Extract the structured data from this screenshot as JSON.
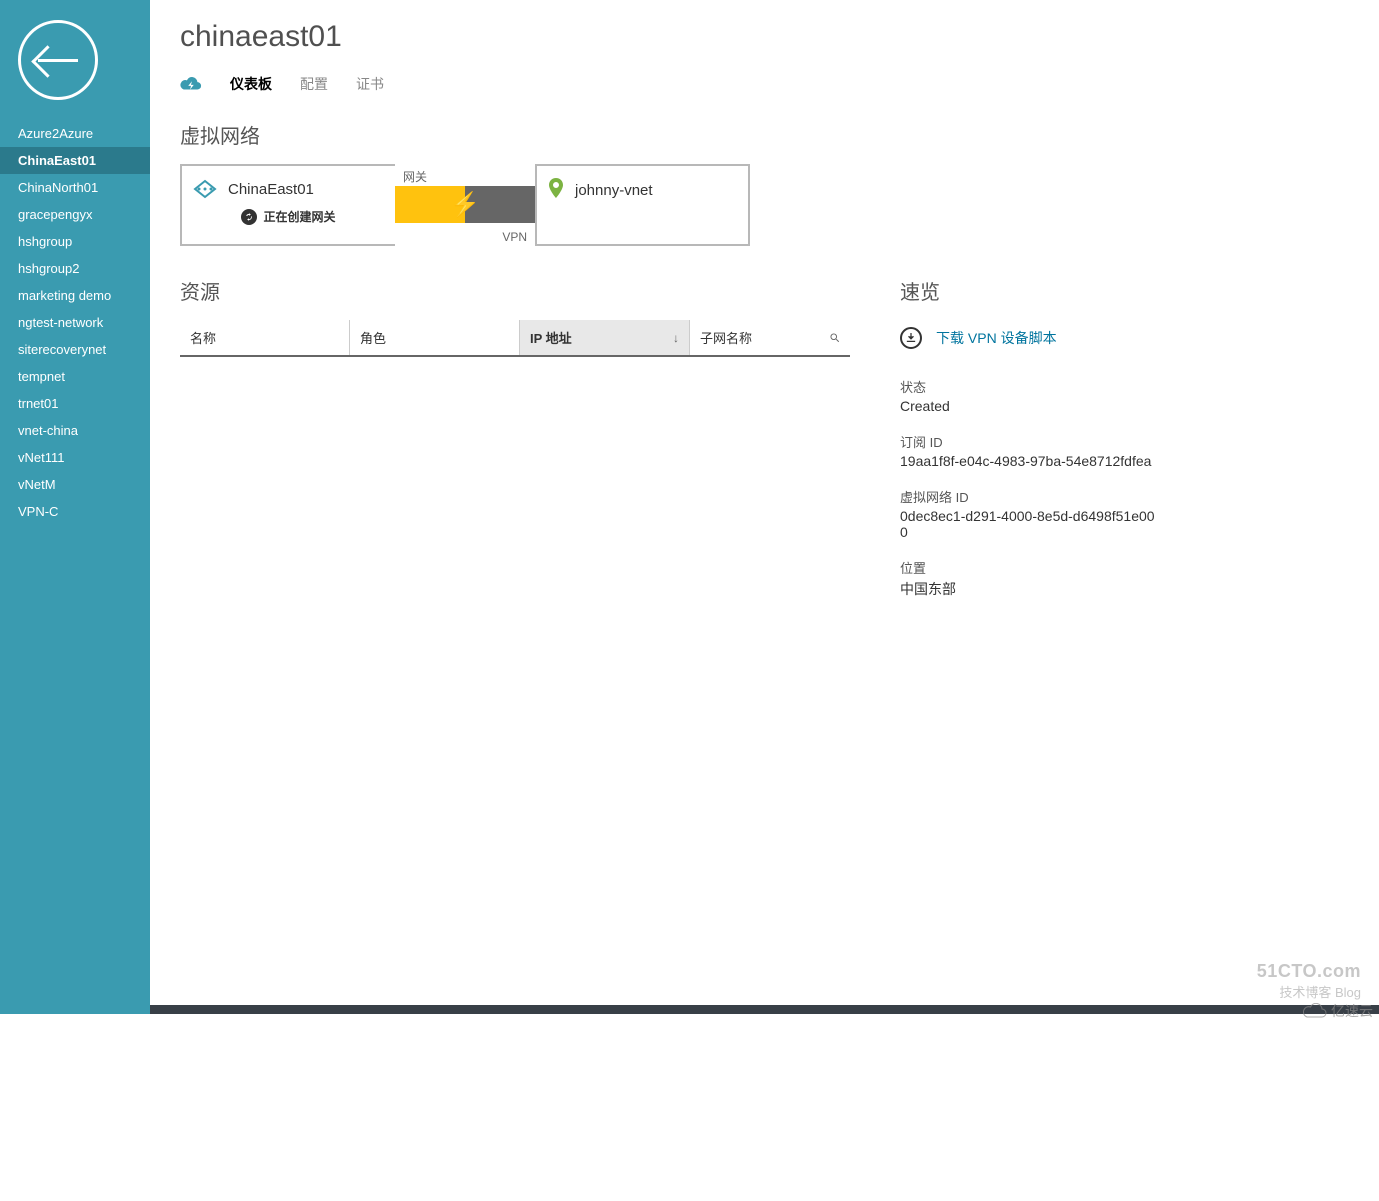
{
  "page": {
    "title": "chinaeast01"
  },
  "sidebar": {
    "items": [
      {
        "label": "Azure2Azure"
      },
      {
        "label": "ChinaEast01",
        "active": true
      },
      {
        "label": "ChinaNorth01"
      },
      {
        "label": "gracepengyx"
      },
      {
        "label": "hshgroup"
      },
      {
        "label": "hshgroup2"
      },
      {
        "label": "marketing demo"
      },
      {
        "label": "ngtest-network"
      },
      {
        "label": "siterecoverynet"
      },
      {
        "label": "tempnet"
      },
      {
        "label": "trnet01"
      },
      {
        "label": "vnet-china"
      },
      {
        "label": "vNet111"
      },
      {
        "label": "vNetM"
      },
      {
        "label": "VPN-C"
      }
    ]
  },
  "tabs": {
    "dashboard": "仪表板",
    "configure": "配置",
    "certificates": "证书"
  },
  "vnet": {
    "section_title": "虚拟网络",
    "local_name": "ChinaEast01",
    "status": "正在创建网关",
    "gateway_label": "网关",
    "vpn_label": "VPN",
    "remote_name": "johnny-vnet"
  },
  "resources": {
    "section_title": "资源",
    "columns": {
      "name": "名称",
      "role": "角色",
      "ip": "IP 地址",
      "subnet": "子网名称"
    }
  },
  "quick": {
    "title": "速览",
    "download_label": "下载 VPN 设备脚本",
    "status_label": "状态",
    "status_value": "Created",
    "subscription_label": "订阅 ID",
    "subscription_value": "19aa1f8f-e04c-4983-97ba-54e8712fdfea",
    "vnet_id_label": "虚拟网络 ID",
    "vnet_id_value": "0dec8ec1-d291-4000-8e5d-d6498f51e000",
    "location_label": "位置",
    "location_value": "中国东部"
  },
  "watermarks": {
    "cto_line1": "51CTO.com",
    "cto_line2": "技术博客  Blog",
    "yisu": "亿速云"
  }
}
